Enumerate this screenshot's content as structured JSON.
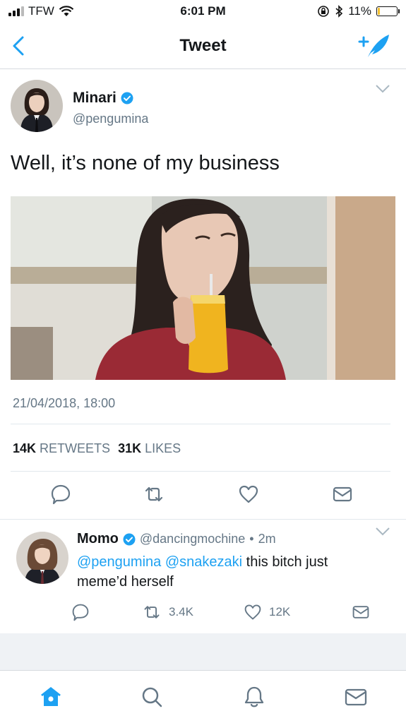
{
  "status_bar": {
    "carrier": "TFW",
    "time": "6:01 PM",
    "battery_percent": "11%",
    "battery_level": 0.11,
    "icons": [
      "signal-icon",
      "wifi-icon",
      "rotation-lock-icon",
      "bluetooth-icon",
      "battery-icon"
    ]
  },
  "nav": {
    "title": "Tweet",
    "back_icon": "chevron-left-icon",
    "compose_icon": "compose-tweet-icon"
  },
  "tweet": {
    "author_name": "Minari",
    "author_handle": "@pengumina",
    "verified": true,
    "text": "Well, it’s none of my business",
    "timestamp": "21/04/2018, 18:00",
    "retweets_count": "14K",
    "retweets_label": "RETWEETS",
    "likes_count": "31K",
    "likes_label": "LIKES",
    "actions": [
      "reply-icon",
      "retweet-icon",
      "like-icon",
      "direct-message-icon"
    ]
  },
  "reply": {
    "author_name": "Momo",
    "verified": true,
    "author_handle": "@dancingmochine",
    "separator": "•",
    "time_ago": "2m",
    "mention_1": "@pengumina",
    "mention_2": "@snakezaki",
    "text_rest": " this bitch just meme’d herself",
    "retweets": "3.4K",
    "likes": "12K"
  },
  "tab_bar": {
    "items": [
      "home-icon",
      "search-icon",
      "notifications-icon",
      "messages-icon"
    ],
    "active": "home-icon"
  },
  "colors": {
    "accent": "#1da1f2",
    "secondary_text": "#657786",
    "battery_low": "#f5c12e"
  }
}
